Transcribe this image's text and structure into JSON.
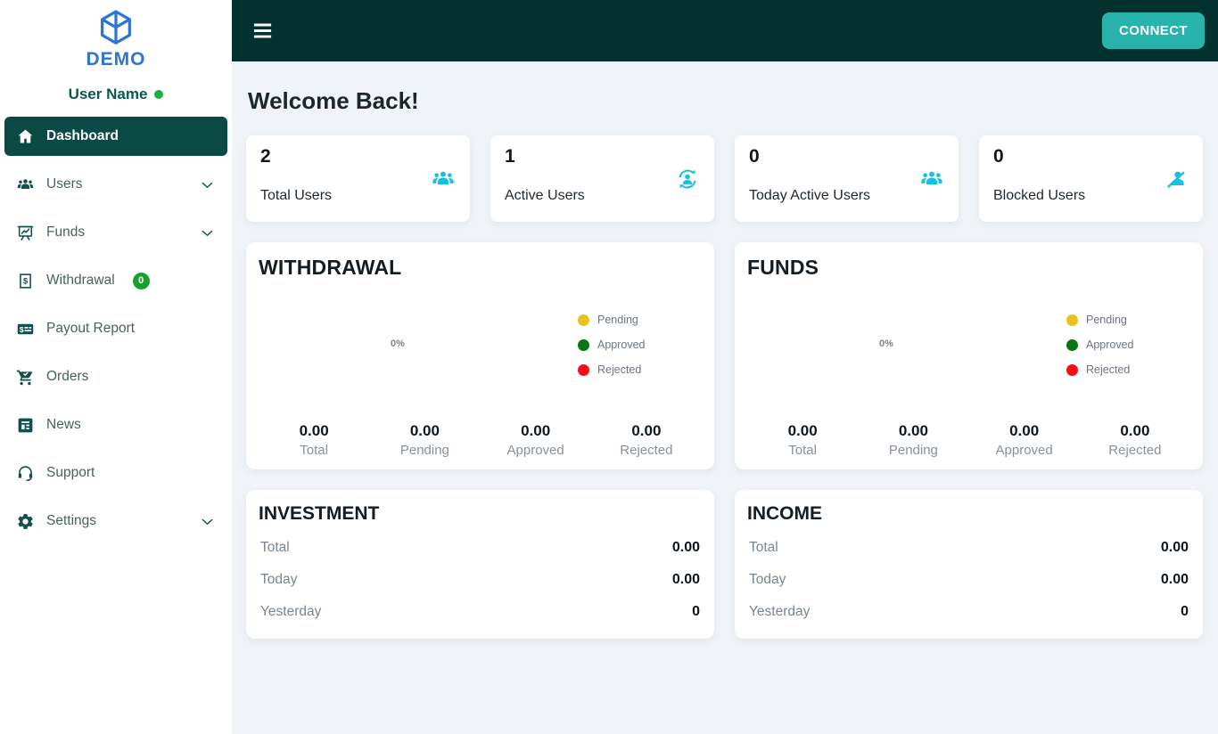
{
  "colors": {
    "topbar": "#03322e",
    "sidebar_active_bg": "#0b4945",
    "accent_teal": "#28b3ab",
    "icon_cyan": "#17c1dd",
    "badge_green": "#17a12b",
    "logo_blue": "#2f74d0",
    "online_dot_green": "#1faf39",
    "pending_yellow": "#e8c21b",
    "approved_green": "#067714",
    "rejected_red": "#fb0d17"
  },
  "sidebar": {
    "logo_text": "DEMO",
    "user_name": "User Name",
    "items": [
      {
        "label": "Dashboard",
        "active": true
      },
      {
        "label": "Users",
        "expandable": true
      },
      {
        "label": "Funds",
        "expandable": true
      },
      {
        "label": "Withdrawal",
        "badge": "0"
      },
      {
        "label": "Payout Report"
      },
      {
        "label": "Orders"
      },
      {
        "label": "News"
      },
      {
        "label": "Support"
      },
      {
        "label": "Settings",
        "expandable": true
      }
    ]
  },
  "topbar": {
    "connect_label": "CONNECT"
  },
  "main": {
    "welcome_title": "Welcome Back!",
    "stat_cards": [
      {
        "value": "2",
        "label": "Total Users",
        "icon": "group-users-icon"
      },
      {
        "value": "1",
        "label": "Active Users",
        "icon": "active-users-icon"
      },
      {
        "value": "0",
        "label": "Today Active Users",
        "icon": "group-users-icon"
      },
      {
        "value": "0",
        "label": "Blocked Users",
        "icon": "blocked-user-icon"
      }
    ],
    "chart_cards": [
      {
        "title": "WITHDRAWAL",
        "center_label": "0%",
        "legend": [
          {
            "label": "Pending",
            "color": "#e8c21b"
          },
          {
            "label": "Approved",
            "color": "#067714"
          },
          {
            "label": "Rejected",
            "color": "#fb0d17"
          }
        ],
        "stats": [
          {
            "value": "0.00",
            "label": "Total"
          },
          {
            "value": "0.00",
            "label": "Pending"
          },
          {
            "value": "0.00",
            "label": "Approved"
          },
          {
            "value": "0.00",
            "label": "Rejected"
          }
        ]
      },
      {
        "title": "FUNDS",
        "center_label": "0%",
        "legend": [
          {
            "label": "Pending",
            "color": "#e8c21b"
          },
          {
            "label": "Approved",
            "color": "#067714"
          },
          {
            "label": "Rejected",
            "color": "#fb0d17"
          }
        ],
        "stats": [
          {
            "value": "0.00",
            "label": "Total"
          },
          {
            "value": "0.00",
            "label": "Pending"
          },
          {
            "value": "0.00",
            "label": "Approved"
          },
          {
            "value": "0.00",
            "label": "Rejected"
          }
        ]
      }
    ],
    "summary_cards": [
      {
        "title": "INVESTMENT",
        "rows": [
          {
            "label": "Total",
            "value": "0.00"
          },
          {
            "label": "Today",
            "value": "0.00"
          },
          {
            "label": "Yesterday",
            "value": "0"
          }
        ]
      },
      {
        "title": "INCOME",
        "rows": [
          {
            "label": "Total",
            "value": "0.00"
          },
          {
            "label": "Today",
            "value": "0.00"
          },
          {
            "label": "Yesterday",
            "value": "0"
          }
        ]
      }
    ]
  },
  "chart_data": [
    {
      "type": "pie",
      "subtype": "donut",
      "title": "WITHDRAWAL",
      "labels": [
        "Pending",
        "Approved",
        "Rejected"
      ],
      "values": [
        0,
        0,
        0
      ],
      "colors": [
        "#e8c21b",
        "#067714",
        "#fb0d17"
      ],
      "center_label": "0%",
      "legend_position": "right",
      "footer_stats": {
        "Total": "0.00",
        "Pending": "0.00",
        "Approved": "0.00",
        "Rejected": "0.00"
      }
    },
    {
      "type": "pie",
      "subtype": "donut",
      "title": "FUNDS",
      "labels": [
        "Pending",
        "Approved",
        "Rejected"
      ],
      "values": [
        0,
        0,
        0
      ],
      "colors": [
        "#e8c21b",
        "#067714",
        "#fb0d17"
      ],
      "center_label": "0%",
      "legend_position": "right",
      "footer_stats": {
        "Total": "0.00",
        "Pending": "0.00",
        "Approved": "0.00",
        "Rejected": "0.00"
      }
    }
  ]
}
